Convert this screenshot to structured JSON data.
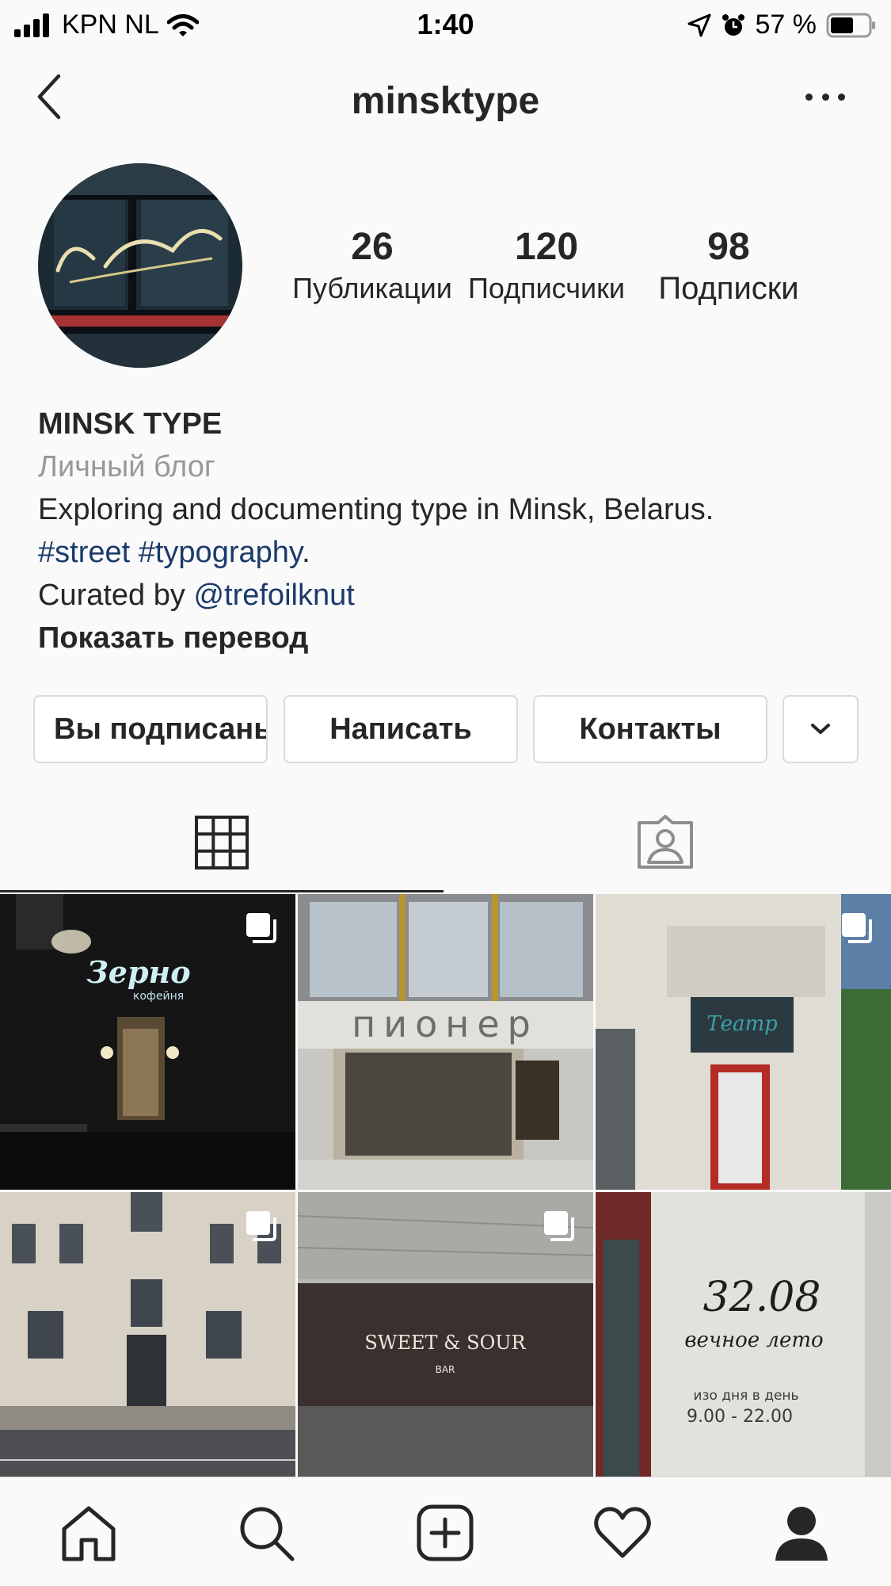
{
  "status_bar": {
    "carrier": "KPN NL",
    "time": "1:40",
    "battery": "57 %"
  },
  "header": {
    "username": "minsktype"
  },
  "profile": {
    "stats": [
      {
        "value": "26",
        "label": "Публикации"
      },
      {
        "value": "120",
        "label": "Подписчики"
      },
      {
        "value": "98",
        "label": "Подписки"
      }
    ],
    "name": "MINSK TYPE",
    "category": "Личный блог",
    "bio_line1": "Exploring and documenting type in Minsk, Belarus.",
    "hashtag_street": "#street",
    "hashtag_typography": "#typography",
    "bio_period": ".",
    "curated_prefix": "Curated by ",
    "curated_handle": "@trefoilknut",
    "show_translation": "Показать перевод"
  },
  "actions": {
    "following": "Вы подписаны",
    "message": "Написать",
    "contacts": "Контакты"
  },
  "grid": {
    "tiles": [
      {
        "sign": "Зерно",
        "sub": "кофейня",
        "multi": true
      },
      {
        "sign": "пионер",
        "multi": false
      },
      {
        "sign": "Театр",
        "multi": true
      },
      {
        "sign": "",
        "multi": true
      },
      {
        "sign": "SWEET & SOUR",
        "sub": "BAR",
        "multi": true
      },
      {
        "sign": "32.08",
        "sub": "вечное лето",
        "hours_label": "изо дня в день",
        "hours": "9.00 - 22.00",
        "multi": false
      }
    ]
  },
  "tab_bar": {
    "items": [
      "home-icon",
      "search-icon",
      "new-post-icon",
      "activity-heart-icon",
      "profile-icon"
    ]
  },
  "colors": {
    "text": "#262626",
    "link": "#1b3a6b",
    "muted": "#999999",
    "border": "#dbdbdb"
  }
}
